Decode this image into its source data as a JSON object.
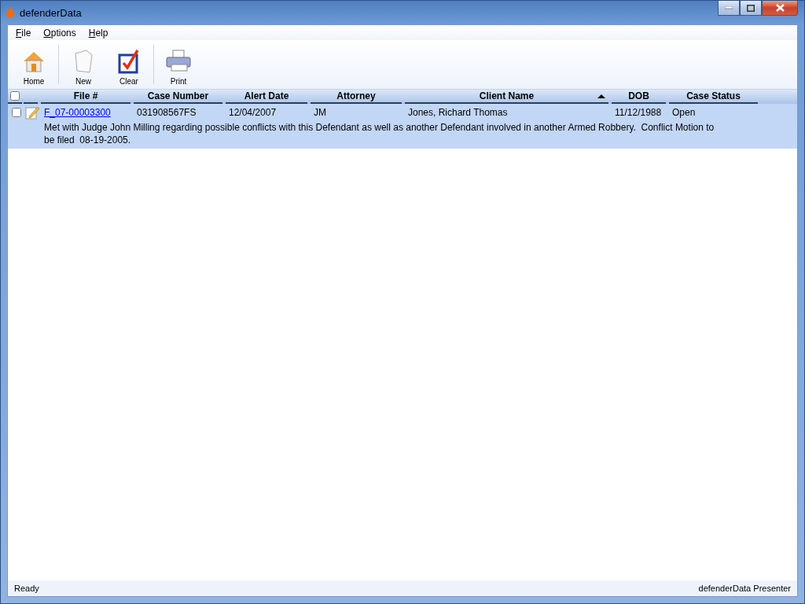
{
  "window": {
    "title": "defenderData"
  },
  "menu": [
    "File",
    "Options",
    "Help"
  ],
  "toolbar": [
    {
      "kind": "home",
      "label": "Home"
    },
    {
      "kind": "new",
      "label": "New"
    },
    {
      "kind": "clear",
      "label": "Clear"
    },
    {
      "kind": "print",
      "label": "Print"
    }
  ],
  "table": {
    "select_all": {
      "checked": false
    },
    "columns": [
      {
        "label": "File #",
        "sorted": false
      },
      {
        "label": "Case Number",
        "sorted": false
      },
      {
        "label": "Alert Date",
        "sorted": false
      },
      {
        "label": "Attorney",
        "sorted": false
      },
      {
        "label": "Client Name",
        "sorted": true
      },
      {
        "label": "DOB",
        "sorted": false
      },
      {
        "label": "Case Status",
        "sorted": false
      }
    ],
    "rows": [
      {
        "checked": false,
        "selected": true,
        "cells": [
          "F_07-00003300",
          "031908567FS",
          "12/04/2007",
          "JM",
          "Jones, Richard Thomas",
          "11/12/1988",
          "Open"
        ],
        "note": "Met with Judge John Milling regarding possible conflicts with this Defendant as well as another Defendant involved in another Armed Robbery.  Conflict Motion to be filed  08-19-2005."
      }
    ]
  },
  "status_bar": {
    "left": "Ready",
    "right": "defenderData Presenter"
  }
}
